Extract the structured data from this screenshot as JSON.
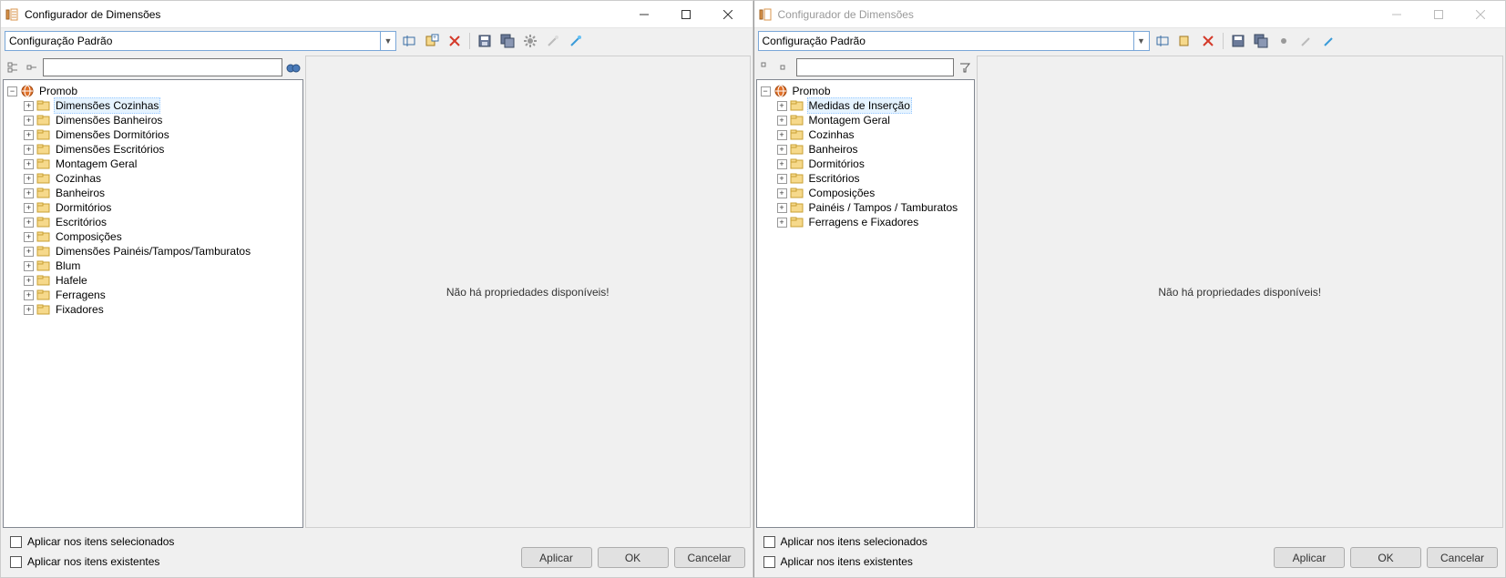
{
  "windows": [
    {
      "active": true,
      "title": "Configurador de Dimensões",
      "config_label": "Configuração Padrão",
      "root_label": "Promob",
      "selected_index": 0,
      "tree": [
        "Dimensões Cozinhas",
        "Dimensões Banheiros",
        "Dimensões Dormitórios",
        "Dimensões Escritórios",
        "Montagem Geral",
        "Cozinhas",
        "Banheiros",
        "Dormitórios",
        "Escritórios",
        "Composições",
        "Dimensões Painéis/Tampos/Tamburatos",
        "Blum",
        "Hafele",
        "Ferragens",
        "Fixadores"
      ],
      "right_message": "Não há propriedades disponíveis!",
      "chk_selected": "Aplicar nos itens selecionados",
      "chk_existing": "Aplicar nos itens existentes",
      "btn_apply": "Aplicar",
      "btn_ok": "OK",
      "btn_cancel": "Cancelar",
      "show_binoculars": true,
      "tree_narrow": false
    },
    {
      "active": false,
      "title": "Configurador de Dimensões",
      "config_label": "Configuração Padrão",
      "root_label": "Promob",
      "selected_index": 0,
      "tree": [
        "Medidas de Inserção",
        "Montagem Geral",
        "Cozinhas",
        "Banheiros",
        "Dormitórios",
        "Escritórios",
        "Composições",
        "Painéis / Tampos / Tamburatos",
        "Ferragens e  Fixadores"
      ],
      "right_message": "Não há propriedades disponíveis!",
      "chk_selected": "Aplicar nos itens selecionados",
      "chk_existing": "Aplicar nos itens existentes",
      "btn_apply": "Aplicar",
      "btn_ok": "OK",
      "btn_cancel": "Cancelar",
      "show_binoculars": false,
      "tree_narrow": true
    }
  ]
}
